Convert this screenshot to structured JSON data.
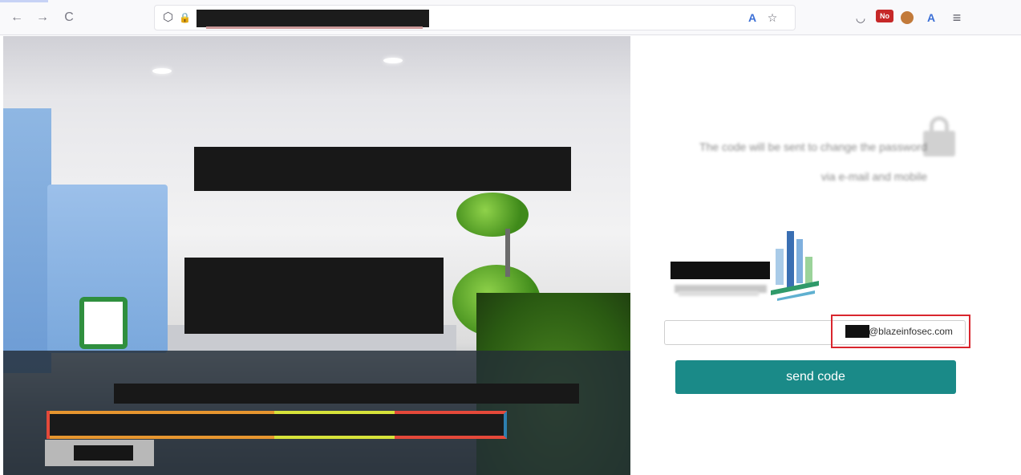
{
  "browser": {
    "back_glyph": "←",
    "forward_glyph": "→",
    "reload_glyph": "C",
    "shield_glyph": "⬡",
    "lock_glyph": "🔒",
    "translate_glyph": "A",
    "star_glyph": "☆",
    "pocket_glyph": "◡",
    "menu_glyph": "≡"
  },
  "reset_panel": {
    "info_text": "The code will be sent to change the password via e-mail and mobile",
    "email_domain": "@blazeinfosec.com",
    "send_code_label": "send code"
  },
  "colors": {
    "button": "#1a8a88",
    "highlight": "#d9262e"
  }
}
